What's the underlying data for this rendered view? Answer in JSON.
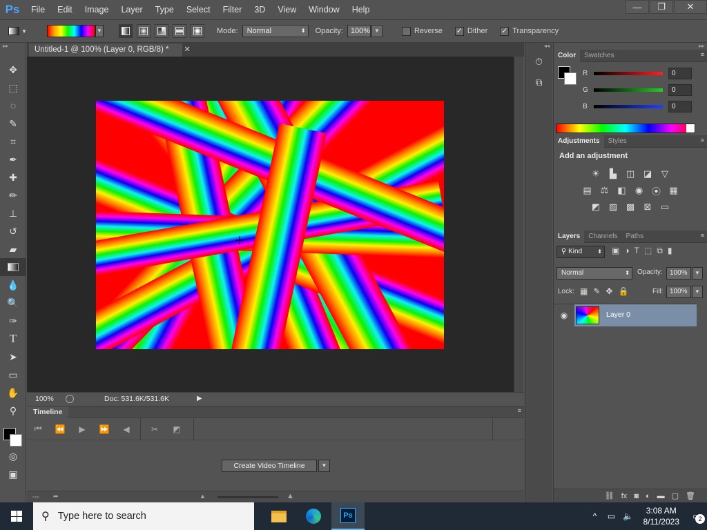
{
  "menubar": {
    "logo": "Ps",
    "items": [
      "File",
      "Edit",
      "Image",
      "Layer",
      "Type",
      "Select",
      "Filter",
      "3D",
      "View",
      "Window",
      "Help"
    ],
    "controls": {
      "minimize": "—",
      "restore": "❐",
      "close": "✕"
    }
  },
  "options": {
    "mode_label": "Mode:",
    "mode_value": "Normal",
    "opacity_label": "Opacity:",
    "opacity_value": "100%",
    "reverse_label": "Reverse",
    "reverse_checked": false,
    "dither_label": "Dither",
    "dither_checked": true,
    "transparency_label": "Transparency",
    "transparency_checked": true
  },
  "document": {
    "tab_title": "Untitled-1 @ 100% (Layer 0, RGB/8) *",
    "zoom": "100%",
    "doc_info": "Doc: 531.6K/531.6K"
  },
  "timeline": {
    "tab": "Timeline",
    "create_button": "Create Video Timeline"
  },
  "color_panel": {
    "tabs": [
      "Color",
      "Swatches"
    ],
    "r_label": "R",
    "g_label": "G",
    "b_label": "B",
    "r_value": "0",
    "g_value": "0",
    "b_value": "0",
    "colors": {
      "r": "#e01010",
      "g": "#10c010",
      "b": "#1030e0"
    }
  },
  "adjustments": {
    "tabs": [
      "Adjustments",
      "Styles"
    ],
    "title": "Add an adjustment"
  },
  "layers": {
    "tabs": [
      "Layers",
      "Channels",
      "Paths"
    ],
    "filter": "Kind",
    "blend": "Normal",
    "opacity_label": "Opacity:",
    "opacity_value": "100%",
    "lock_label": "Lock:",
    "fill_label": "Fill:",
    "fill_value": "100%",
    "layer_name": "Layer 0"
  },
  "taskbar": {
    "search_placeholder": "Type here to search",
    "time": "3:08 AM",
    "date": "8/11/2023",
    "notifications": "2",
    "ps_label": "Ps"
  }
}
